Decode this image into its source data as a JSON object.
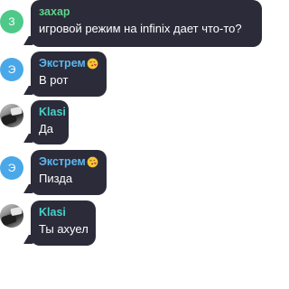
{
  "messages": [
    {
      "sender": "захар",
      "avatar_letter": "З",
      "avatar_color": "#4fc98a",
      "name_color": "#5fd48a",
      "text": "игровой режим на infinix дает что-то?"
    },
    {
      "sender": "Экстрем",
      "sender_emoji": "kissing-heart-emoji",
      "avatar_letter": "Э",
      "avatar_color": "#4aa8e8",
      "name_color": "#5db8f0",
      "text": "В рот"
    },
    {
      "sender": "Klasi",
      "avatar_icon": "user-photo-avatar",
      "name_color": "#48d1c8",
      "text": "Да"
    },
    {
      "sender": "Экстрем",
      "sender_emoji": "kissing-heart-emoji",
      "avatar_letter": "Э",
      "avatar_color": "#4aa8e8",
      "name_color": "#5db8f0",
      "text": "Пизда"
    },
    {
      "sender": "Klasi",
      "avatar_icon": "user-photo-avatar",
      "name_color": "#48d1c8",
      "text": "Ты ахуел"
    }
  ],
  "colors": {
    "bubble_background": "#2b2b3a",
    "page_background": "#ffffff",
    "message_text": "#ffffff"
  }
}
